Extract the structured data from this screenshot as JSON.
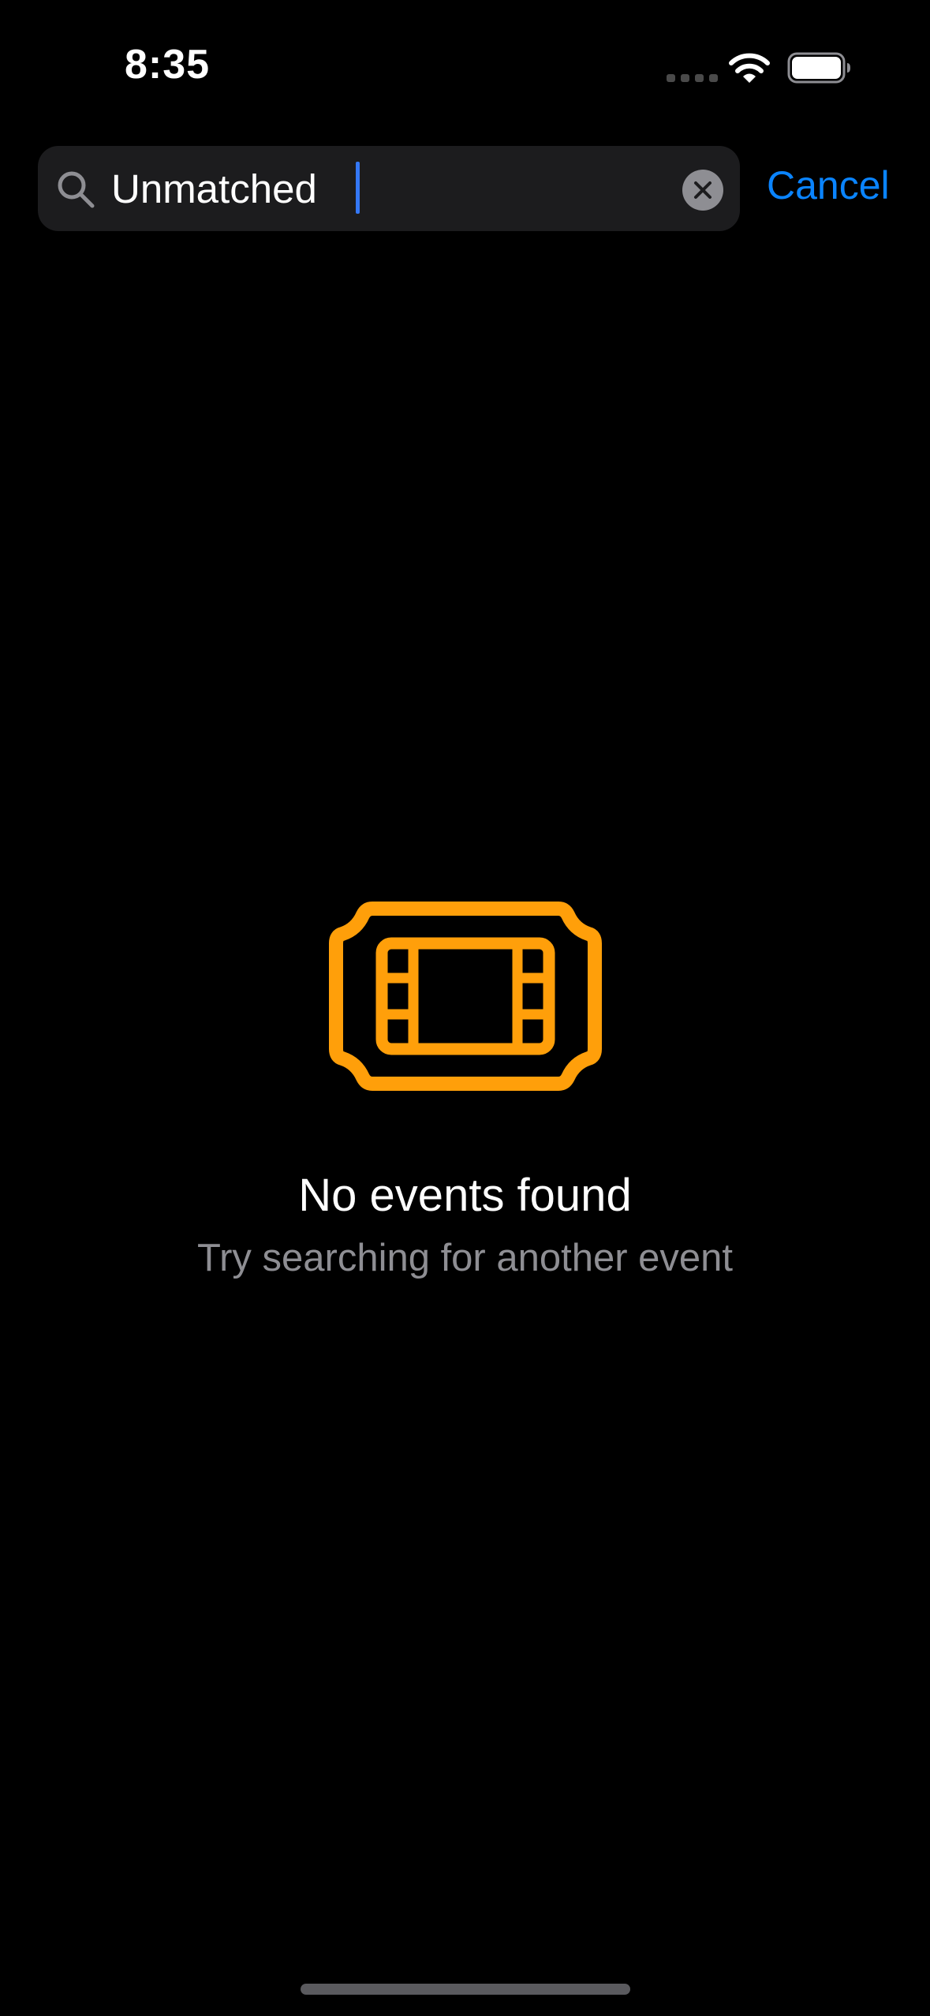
{
  "status_bar": {
    "time": "8:35",
    "icons": [
      "cellular-signal-icon",
      "wifi-icon",
      "battery-icon"
    ]
  },
  "search": {
    "value": "Unmatched",
    "placeholder": "Search",
    "icon": "search-icon",
    "clear_icon": "clear-icon",
    "cancel_label": "Cancel"
  },
  "empty_state": {
    "icon": "ticket-film-icon",
    "title": "No events found",
    "subtitle": "Try searching for another event"
  },
  "colors": {
    "background": "#000000",
    "search_field": "#1c1c1e",
    "accent": "#0a84ff",
    "icon_orange": "#ff9f0a",
    "secondary_text": "#8e8e93"
  }
}
